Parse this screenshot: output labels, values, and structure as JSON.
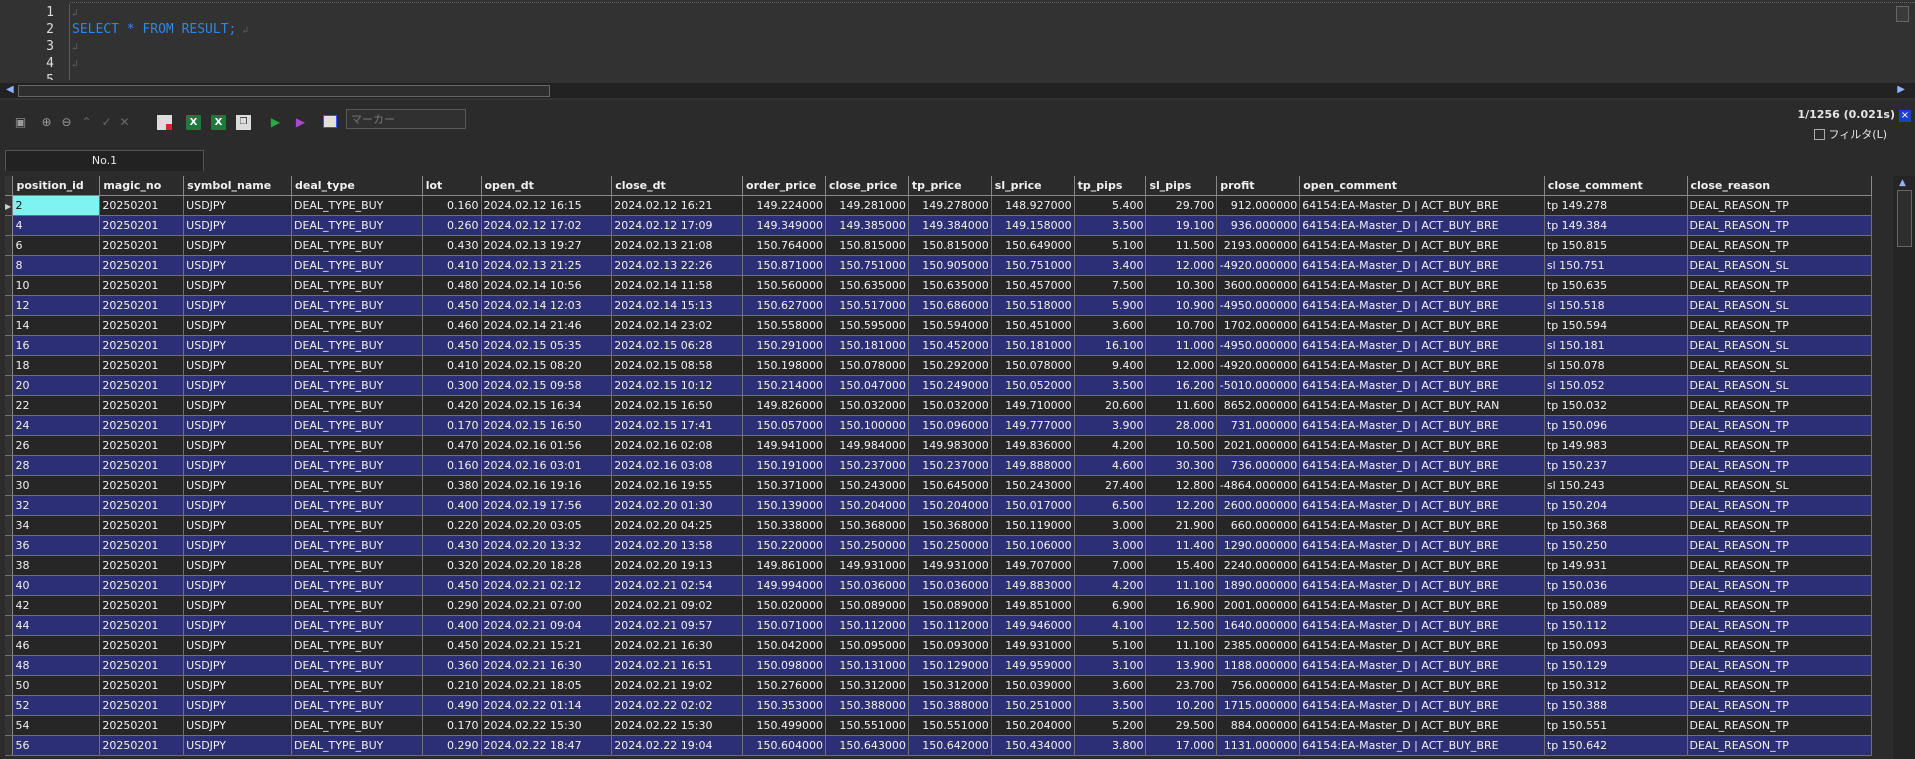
{
  "editor": {
    "line_numbers": [
      "1",
      "2",
      "3",
      "4",
      "5"
    ],
    "lines": [
      {
        "text": "",
        "keyword": false
      },
      {
        "text": "SELECT * FROM RESULT;",
        "keyword": true
      },
      {
        "text": "",
        "keyword": false
      },
      {
        "text": "",
        "keyword": false
      },
      {
        "text": "",
        "keyword": false
      }
    ]
  },
  "toolbar": {
    "marker_placeholder": "マーカー",
    "status": "1/1256 (0.021s)",
    "filter_label": "フィルタ(L)",
    "close_glyph": "×"
  },
  "tab": {
    "label": "No.1"
  },
  "columns": [
    "position_id",
    "magic_no",
    "symbol_name",
    "deal_type",
    "lot",
    "open_dt",
    "close_dt",
    "order_price",
    "close_price",
    "tp_price",
    "sl_price",
    "tp_pips",
    "sl_pips",
    "profit",
    "open_comment",
    "close_comment",
    "close_reason"
  ],
  "rows": [
    [
      "2",
      "20250201",
      "USDJPY",
      "DEAL_TYPE_BUY",
      "0.160",
      "2024.02.12 16:15",
      "2024.02.12 16:21",
      "149.224000",
      "149.281000",
      "149.278000",
      "148.927000",
      "5.400",
      "29.700",
      "912.000000",
      "64154:EA-Master_D | ACT_BUY_BRE",
      "tp 149.278",
      "DEAL_REASON_TP"
    ],
    [
      "4",
      "20250201",
      "USDJPY",
      "DEAL_TYPE_BUY",
      "0.260",
      "2024.02.12 17:02",
      "2024.02.12 17:09",
      "149.349000",
      "149.385000",
      "149.384000",
      "149.158000",
      "3.500",
      "19.100",
      "936.000000",
      "64154:EA-Master_D | ACT_BUY_BRE",
      "tp 149.384",
      "DEAL_REASON_TP"
    ],
    [
      "6",
      "20250201",
      "USDJPY",
      "DEAL_TYPE_BUY",
      "0.430",
      "2024.02.13 19:27",
      "2024.02.13 21:08",
      "150.764000",
      "150.815000",
      "150.815000",
      "150.649000",
      "5.100",
      "11.500",
      "2193.000000",
      "64154:EA-Master_D | ACT_BUY_BRE",
      "tp 150.815",
      "DEAL_REASON_TP"
    ],
    [
      "8",
      "20250201",
      "USDJPY",
      "DEAL_TYPE_BUY",
      "0.410",
      "2024.02.13 21:25",
      "2024.02.13 22:26",
      "150.871000",
      "150.751000",
      "150.905000",
      "150.751000",
      "3.400",
      "12.000",
      "-4920.000000",
      "64154:EA-Master_D | ACT_BUY_BRE",
      "sl 150.751",
      "DEAL_REASON_SL"
    ],
    [
      "10",
      "20250201",
      "USDJPY",
      "DEAL_TYPE_BUY",
      "0.480",
      "2024.02.14 10:56",
      "2024.02.14 11:58",
      "150.560000",
      "150.635000",
      "150.635000",
      "150.457000",
      "7.500",
      "10.300",
      "3600.000000",
      "64154:EA-Master_D | ACT_BUY_BRE",
      "tp 150.635",
      "DEAL_REASON_TP"
    ],
    [
      "12",
      "20250201",
      "USDJPY",
      "DEAL_TYPE_BUY",
      "0.450",
      "2024.02.14 12:03",
      "2024.02.14 15:13",
      "150.627000",
      "150.517000",
      "150.686000",
      "150.518000",
      "5.900",
      "10.900",
      "-4950.000000",
      "64154:EA-Master_D | ACT_BUY_BRE",
      "sl 150.518",
      "DEAL_REASON_SL"
    ],
    [
      "14",
      "20250201",
      "USDJPY",
      "DEAL_TYPE_BUY",
      "0.460",
      "2024.02.14 21:46",
      "2024.02.14 23:02",
      "150.558000",
      "150.595000",
      "150.594000",
      "150.451000",
      "3.600",
      "10.700",
      "1702.000000",
      "64154:EA-Master_D | ACT_BUY_BRE",
      "tp 150.594",
      "DEAL_REASON_TP"
    ],
    [
      "16",
      "20250201",
      "USDJPY",
      "DEAL_TYPE_BUY",
      "0.450",
      "2024.02.15 05:35",
      "2024.02.15 06:28",
      "150.291000",
      "150.181000",
      "150.452000",
      "150.181000",
      "16.100",
      "11.000",
      "-4950.000000",
      "64154:EA-Master_D | ACT_BUY_BRE",
      "sl 150.181",
      "DEAL_REASON_SL"
    ],
    [
      "18",
      "20250201",
      "USDJPY",
      "DEAL_TYPE_BUY",
      "0.410",
      "2024.02.15 08:20",
      "2024.02.15 08:58",
      "150.198000",
      "150.078000",
      "150.292000",
      "150.078000",
      "9.400",
      "12.000",
      "-4920.000000",
      "64154:EA-Master_D | ACT_BUY_BRE",
      "sl 150.078",
      "DEAL_REASON_SL"
    ],
    [
      "20",
      "20250201",
      "USDJPY",
      "DEAL_TYPE_BUY",
      "0.300",
      "2024.02.15 09:58",
      "2024.02.15 10:12",
      "150.214000",
      "150.047000",
      "150.249000",
      "150.052000",
      "3.500",
      "16.200",
      "-5010.000000",
      "64154:EA-Master_D | ACT_BUY_BRE",
      "sl 150.052",
      "DEAL_REASON_SL"
    ],
    [
      "22",
      "20250201",
      "USDJPY",
      "DEAL_TYPE_BUY",
      "0.420",
      "2024.02.15 16:34",
      "2024.02.15 16:50",
      "149.826000",
      "150.032000",
      "150.032000",
      "149.710000",
      "20.600",
      "11.600",
      "8652.000000",
      "64154:EA-Master_D | ACT_BUY_RAN",
      "tp 150.032",
      "DEAL_REASON_TP"
    ],
    [
      "24",
      "20250201",
      "USDJPY",
      "DEAL_TYPE_BUY",
      "0.170",
      "2024.02.15 16:50",
      "2024.02.15 17:41",
      "150.057000",
      "150.100000",
      "150.096000",
      "149.777000",
      "3.900",
      "28.000",
      "731.000000",
      "64154:EA-Master_D | ACT_BUY_BRE",
      "tp 150.096",
      "DEAL_REASON_TP"
    ],
    [
      "26",
      "20250201",
      "USDJPY",
      "DEAL_TYPE_BUY",
      "0.470",
      "2024.02.16 01:56",
      "2024.02.16 02:08",
      "149.941000",
      "149.984000",
      "149.983000",
      "149.836000",
      "4.200",
      "10.500",
      "2021.000000",
      "64154:EA-Master_D | ACT_BUY_BRE",
      "tp 149.983",
      "DEAL_REASON_TP"
    ],
    [
      "28",
      "20250201",
      "USDJPY",
      "DEAL_TYPE_BUY",
      "0.160",
      "2024.02.16 03:01",
      "2024.02.16 03:08",
      "150.191000",
      "150.237000",
      "150.237000",
      "149.888000",
      "4.600",
      "30.300",
      "736.000000",
      "64154:EA-Master_D | ACT_BUY_BRE",
      "tp 150.237",
      "DEAL_REASON_TP"
    ],
    [
      "30",
      "20250201",
      "USDJPY",
      "DEAL_TYPE_BUY",
      "0.380",
      "2024.02.16 19:16",
      "2024.02.16 19:55",
      "150.371000",
      "150.243000",
      "150.645000",
      "150.243000",
      "27.400",
      "12.800",
      "-4864.000000",
      "64154:EA-Master_D | ACT_BUY_BRE",
      "sl 150.243",
      "DEAL_REASON_SL"
    ],
    [
      "32",
      "20250201",
      "USDJPY",
      "DEAL_TYPE_BUY",
      "0.400",
      "2024.02.19 17:56",
      "2024.02.20 01:30",
      "150.139000",
      "150.204000",
      "150.204000",
      "150.017000",
      "6.500",
      "12.200",
      "2600.000000",
      "64154:EA-Master_D | ACT_BUY_BRE",
      "tp 150.204",
      "DEAL_REASON_TP"
    ],
    [
      "34",
      "20250201",
      "USDJPY",
      "DEAL_TYPE_BUY",
      "0.220",
      "2024.02.20 03:05",
      "2024.02.20 04:25",
      "150.338000",
      "150.368000",
      "150.368000",
      "150.119000",
      "3.000",
      "21.900",
      "660.000000",
      "64154:EA-Master_D | ACT_BUY_BRE",
      "tp 150.368",
      "DEAL_REASON_TP"
    ],
    [
      "36",
      "20250201",
      "USDJPY",
      "DEAL_TYPE_BUY",
      "0.430",
      "2024.02.20 13:32",
      "2024.02.20 13:58",
      "150.220000",
      "150.250000",
      "150.250000",
      "150.106000",
      "3.000",
      "11.400",
      "1290.000000",
      "64154:EA-Master_D | ACT_BUY_BRE",
      "tp 150.250",
      "DEAL_REASON_TP"
    ],
    [
      "38",
      "20250201",
      "USDJPY",
      "DEAL_TYPE_BUY",
      "0.320",
      "2024.02.20 18:28",
      "2024.02.20 19:13",
      "149.861000",
      "149.931000",
      "149.931000",
      "149.707000",
      "7.000",
      "15.400",
      "2240.000000",
      "64154:EA-Master_D | ACT_BUY_BRE",
      "tp 149.931",
      "DEAL_REASON_TP"
    ],
    [
      "40",
      "20250201",
      "USDJPY",
      "DEAL_TYPE_BUY",
      "0.450",
      "2024.02.21 02:12",
      "2024.02.21 02:54",
      "149.994000",
      "150.036000",
      "150.036000",
      "149.883000",
      "4.200",
      "11.100",
      "1890.000000",
      "64154:EA-Master_D | ACT_BUY_BRE",
      "tp 150.036",
      "DEAL_REASON_TP"
    ],
    [
      "42",
      "20250201",
      "USDJPY",
      "DEAL_TYPE_BUY",
      "0.290",
      "2024.02.21 07:00",
      "2024.02.21 09:02",
      "150.020000",
      "150.089000",
      "150.089000",
      "149.851000",
      "6.900",
      "16.900",
      "2001.000000",
      "64154:EA-Master_D | ACT_BUY_BRE",
      "tp 150.089",
      "DEAL_REASON_TP"
    ],
    [
      "44",
      "20250201",
      "USDJPY",
      "DEAL_TYPE_BUY",
      "0.400",
      "2024.02.21 09:04",
      "2024.02.21 09:57",
      "150.071000",
      "150.112000",
      "150.112000",
      "149.946000",
      "4.100",
      "12.500",
      "1640.000000",
      "64154:EA-Master_D | ACT_BUY_BRE",
      "tp 150.112",
      "DEAL_REASON_TP"
    ],
    [
      "46",
      "20250201",
      "USDJPY",
      "DEAL_TYPE_BUY",
      "0.450",
      "2024.02.21 15:21",
      "2024.02.21 16:30",
      "150.042000",
      "150.095000",
      "150.093000",
      "149.931000",
      "5.100",
      "11.100",
      "2385.000000",
      "64154:EA-Master_D | ACT_BUY_BRE",
      "tp 150.093",
      "DEAL_REASON_TP"
    ],
    [
      "48",
      "20250201",
      "USDJPY",
      "DEAL_TYPE_BUY",
      "0.360",
      "2024.02.21 16:30",
      "2024.02.21 16:51",
      "150.098000",
      "150.131000",
      "150.129000",
      "149.959000",
      "3.100",
      "13.900",
      "1188.000000",
      "64154:EA-Master_D | ACT_BUY_BRE",
      "tp 150.129",
      "DEAL_REASON_TP"
    ],
    [
      "50",
      "20250201",
      "USDJPY",
      "DEAL_TYPE_BUY",
      "0.210",
      "2024.02.21 18:05",
      "2024.02.21 19:02",
      "150.276000",
      "150.312000",
      "150.312000",
      "150.039000",
      "3.600",
      "23.700",
      "756.000000",
      "64154:EA-Master_D | ACT_BUY_BRE",
      "tp 150.312",
      "DEAL_REASON_TP"
    ],
    [
      "52",
      "20250201",
      "USDJPY",
      "DEAL_TYPE_BUY",
      "0.490",
      "2024.02.22 01:14",
      "2024.02.22 02:02",
      "150.353000",
      "150.388000",
      "150.388000",
      "150.251000",
      "3.500",
      "10.200",
      "1715.000000",
      "64154:EA-Master_D | ACT_BUY_BRE",
      "tp 150.388",
      "DEAL_REASON_TP"
    ],
    [
      "54",
      "20250201",
      "USDJPY",
      "DEAL_TYPE_BUY",
      "0.170",
      "2024.02.22 15:30",
      "2024.02.22 15:30",
      "150.499000",
      "150.551000",
      "150.551000",
      "150.204000",
      "5.200",
      "29.500",
      "884.000000",
      "64154:EA-Master_D | ACT_BUY_BRE",
      "tp 150.551",
      "DEAL_REASON_TP"
    ],
    [
      "56",
      "20250201",
      "USDJPY",
      "DEAL_TYPE_BUY",
      "0.290",
      "2024.02.22 18:47",
      "2024.02.22 19:04",
      "150.604000",
      "150.643000",
      "150.642000",
      "150.434000",
      "3.800",
      "17.000",
      "1131.000000",
      "64154:EA-Master_D | ACT_BUY_BRE",
      "tp 150.642",
      "DEAL_REASON_TP"
    ]
  ],
  "colors": {
    "row_alt": "#2c2e76",
    "row": "#262626",
    "selected_cell": "#7ff2f2",
    "keyword": "#2f87e6"
  }
}
